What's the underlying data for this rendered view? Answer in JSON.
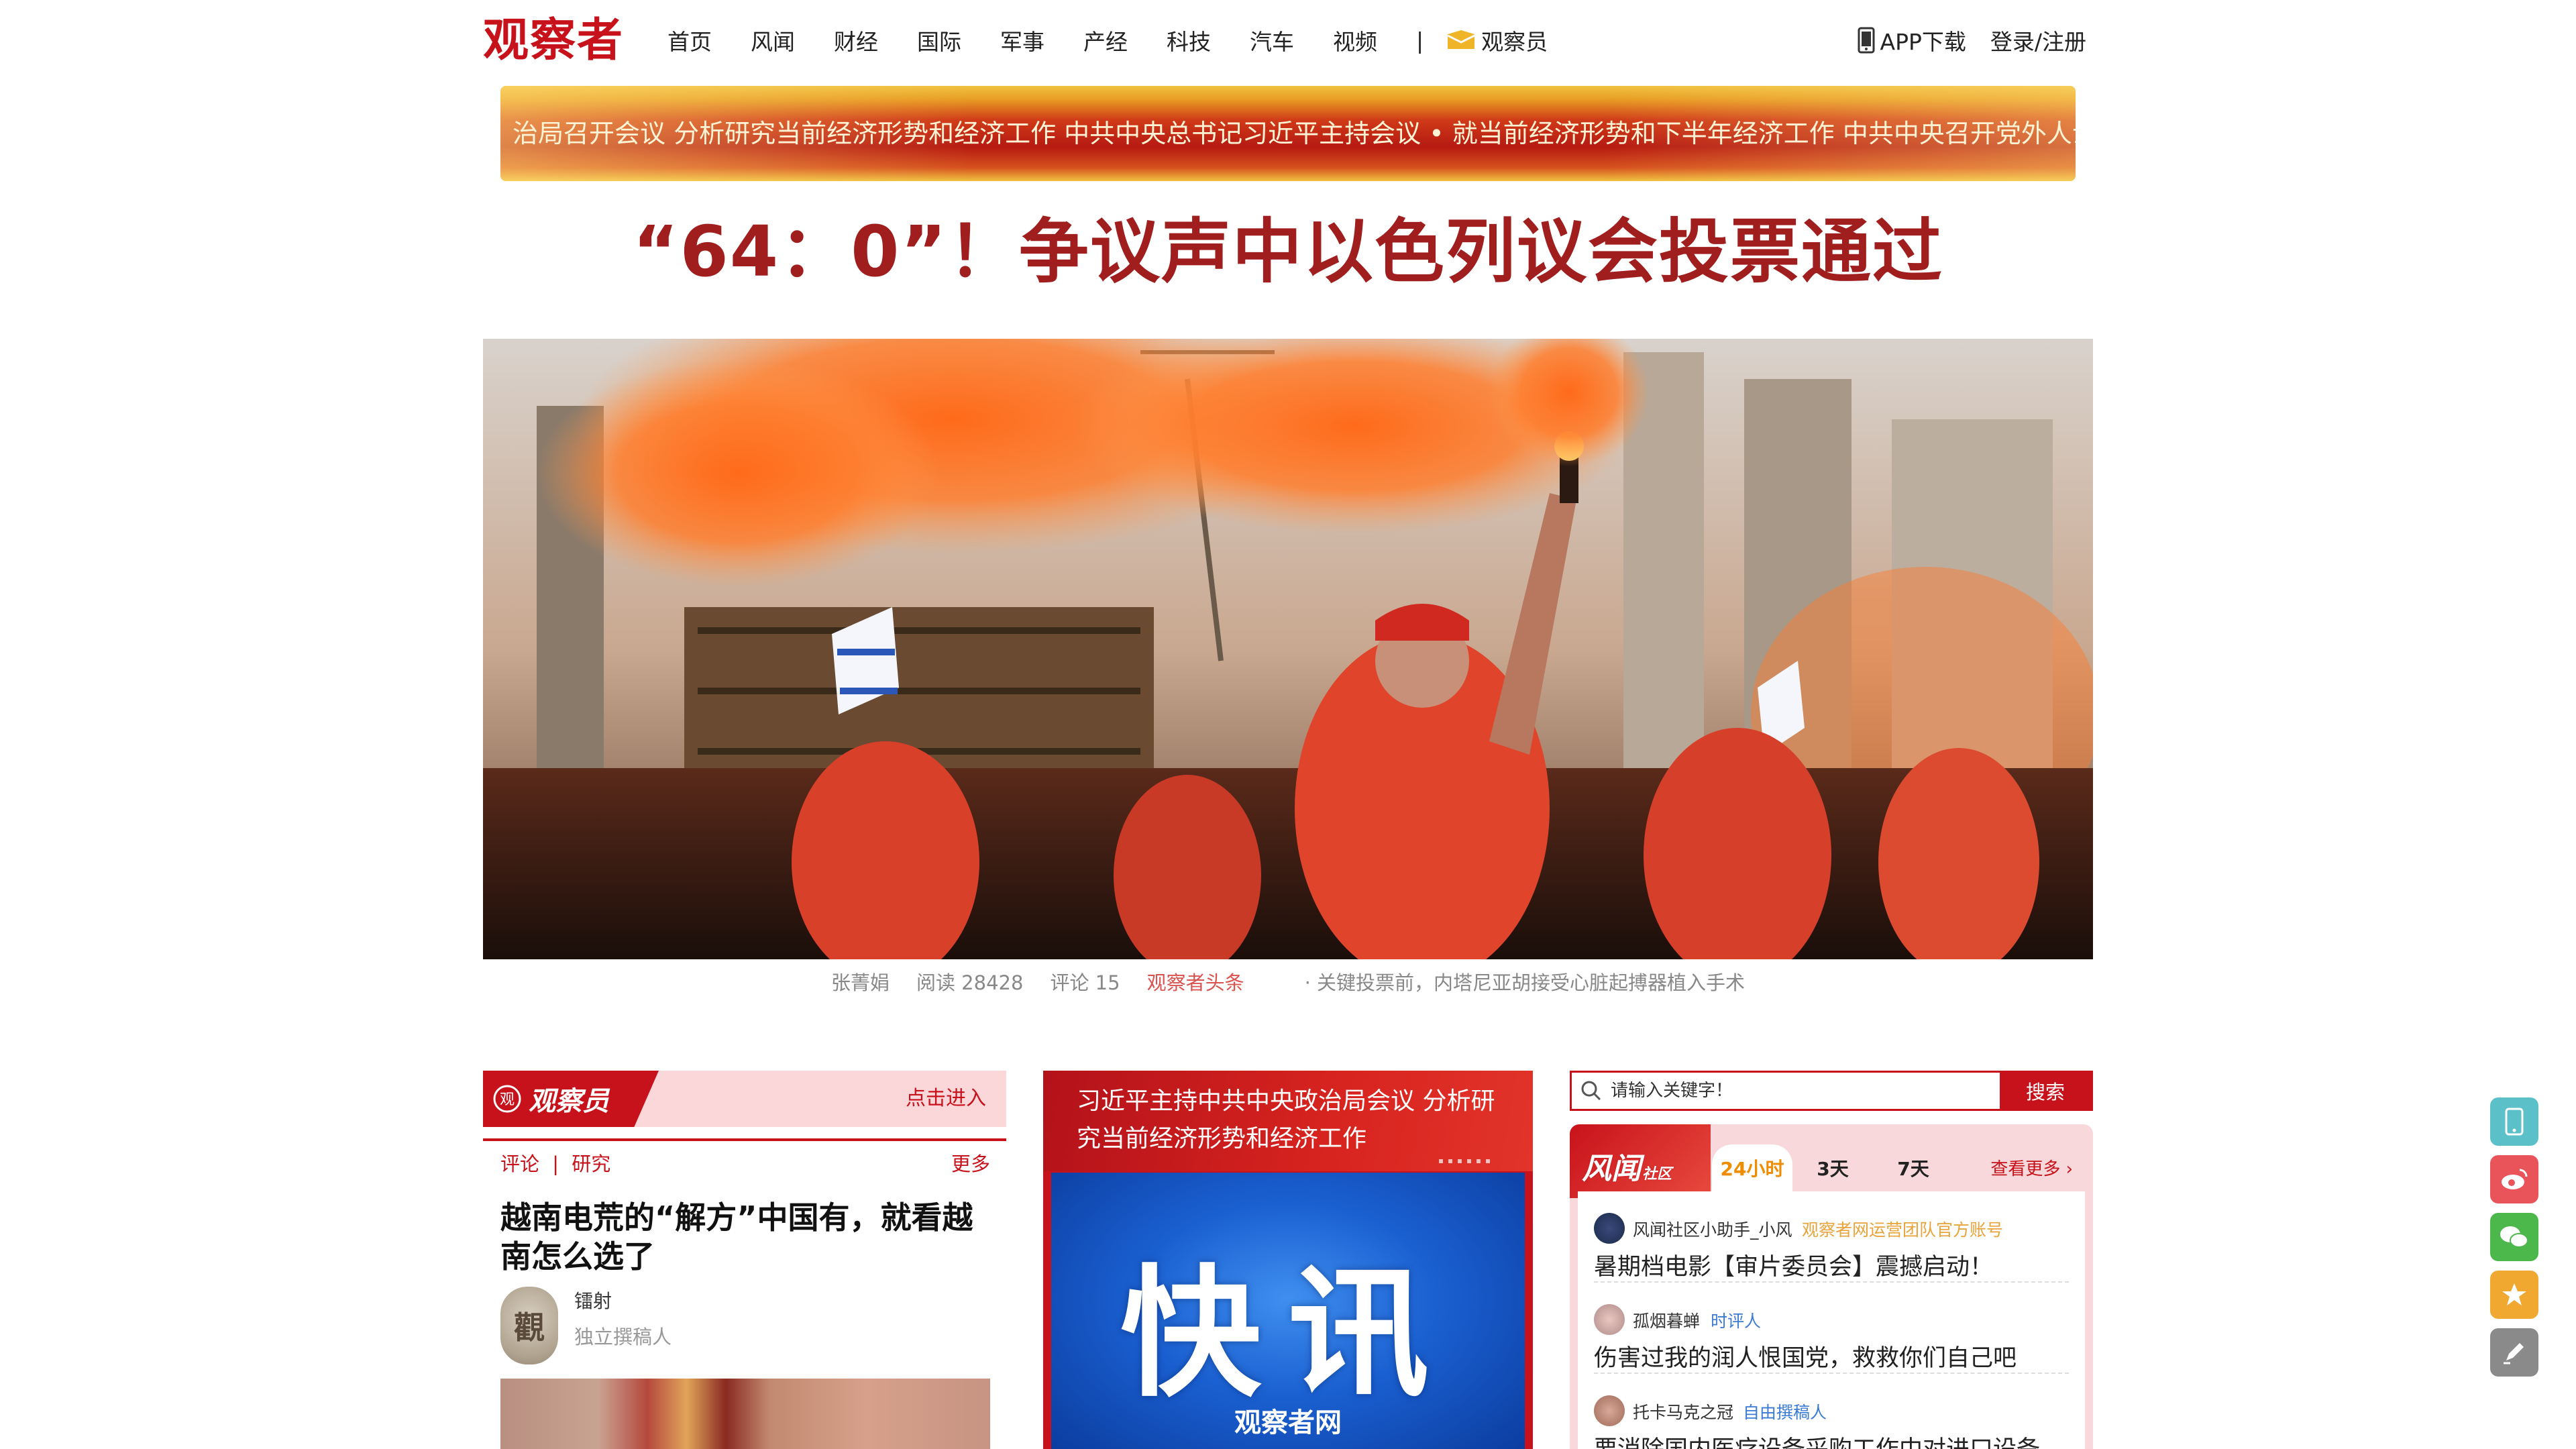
{
  "header": {
    "logo": "观察者",
    "nav": [
      "首页",
      "风闻",
      "财经",
      "国际",
      "军事",
      "产经",
      "科技",
      "汽车",
      "视频"
    ],
    "separator": "|",
    "guanchayuan": "观察员",
    "app_download": "APP下载",
    "login": "登录/注册"
  },
  "banner": {
    "ticker": "治局召开会议 分析研究当前经济形势和经济工作 中共中央总书记习近平主持会议 • 就当前经济形势和下半年经济工作 中共中央召开党外人士座谈会"
  },
  "headline": "“64：0”！争议声中以色列议会投票通过",
  "hero": {
    "author": "张菁娟",
    "reads": "阅读 28428",
    "comments": "评论 15",
    "source": "观察者头条",
    "related": "· 关键投票前，内塔尼亚胡接受心脏起搏器植入手术"
  },
  "left_column": {
    "section_title": "观察员",
    "enter": "点击进入",
    "sub_links": [
      "评论",
      "研究"
    ],
    "sub_sep": "|",
    "more": "更多",
    "article_title": "越南电荒的“解方”中国有，就看越南怎么选了",
    "author_name": "镭射",
    "author_role": "独立撰稿人",
    "avatar_char": "觀"
  },
  "middle_column": {
    "title": "习近平主持中共中央政治局会议 分析研究当前经济形势和经济工作",
    "flash": "快讯",
    "brand": "观察者网"
  },
  "right_column": {
    "search_placeholder": "请输入关键字！",
    "search_button": "搜索",
    "fengwen_logo": "风闻",
    "fengwen_logo_small": "社区",
    "tabs": [
      "24小时",
      "3天",
      "7天"
    ],
    "more": "查看更多 ›",
    "items": [
      {
        "nick": "风闻社区小助手_小风",
        "tag": "观察者网运营团队官方账号",
        "tag_color": "#e8a33a",
        "text": "暑期档电影【审片委员会】震撼启动！"
      },
      {
        "nick": "孤烟暮蝉",
        "tag": "时评人",
        "tag_color": "#3a7bd5",
        "text": "伤害过我的润人恨国党，救救你们自己吧"
      },
      {
        "nick": "托卡马克之冠",
        "tag": "自由撰稿人",
        "tag_color": "#3a7bd5",
        "text": "要消除国内医疗设备采购工作中对进口设备"
      }
    ]
  },
  "side_buttons": [
    {
      "icon": "phone-icon",
      "color": "#5bc0c8"
    },
    {
      "icon": "weibo-icon",
      "color": "#e8545a"
    },
    {
      "icon": "wechat-icon",
      "color": "#4cb84c"
    },
    {
      "icon": "star-icon",
      "color": "#f0a830"
    },
    {
      "icon": "pen-icon",
      "color": "#8a8a8a"
    }
  ]
}
